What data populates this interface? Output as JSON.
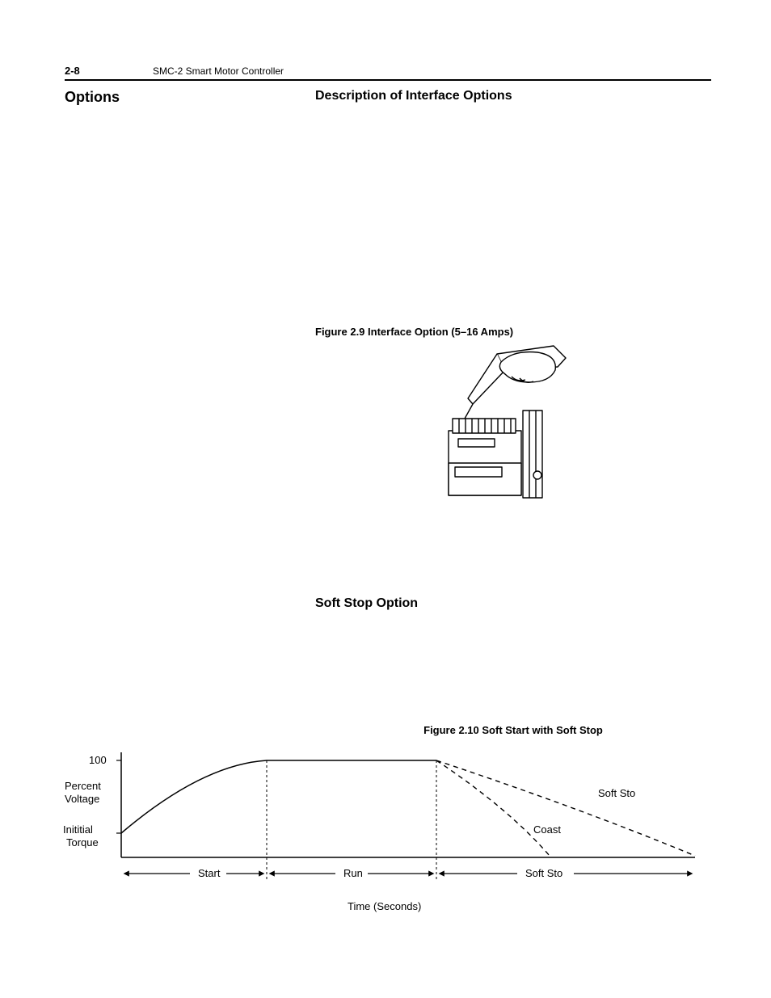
{
  "header": {
    "page_number": "2-8",
    "doc_title": "SMC-2 Smart Motor Controller"
  },
  "left": {
    "section_title": "Options"
  },
  "right": {
    "subsection_title": "Description of Interface Options",
    "figure29_caption": "Figure 2.9   Interface Option (5–16 Amps)",
    "softstop_title": "Soft Stop Option",
    "figure210_caption": "Figure 2.10 Soft Start with Soft Stop"
  },
  "chart_data": {
    "type": "line",
    "title": "Soft Start with Soft Stop",
    "xlabel": "Time (Seconds)",
    "ylabel": "Percent Voltage",
    "y_ticks": [
      {
        "label": "100",
        "value": 100
      },
      {
        "label": "Inititial Torque",
        "value": 25
      }
    ],
    "y_axis_label_text": "Percent Voltage",
    "phases": [
      "Start",
      "Run",
      "Soft Sto"
    ],
    "series": [
      {
        "name": "Soft Sto",
        "points": [
          {
            "phase": "start_begin",
            "x": 0,
            "y": 25
          },
          {
            "phase": "start_end",
            "x": 25,
            "y": 100
          },
          {
            "phase": "run_end",
            "x": 55,
            "y": 100
          },
          {
            "phase": "stop_end",
            "x": 100,
            "y": 0
          }
        ],
        "style": "dashed-after-run"
      },
      {
        "name": "Coast",
        "points": [
          {
            "phase": "run_end",
            "x": 55,
            "y": 100
          },
          {
            "phase": "coast_end",
            "x": 80,
            "y": 0
          }
        ],
        "style": "dashed"
      }
    ],
    "xlim": [
      0,
      100
    ],
    "ylim": [
      0,
      100
    ]
  }
}
